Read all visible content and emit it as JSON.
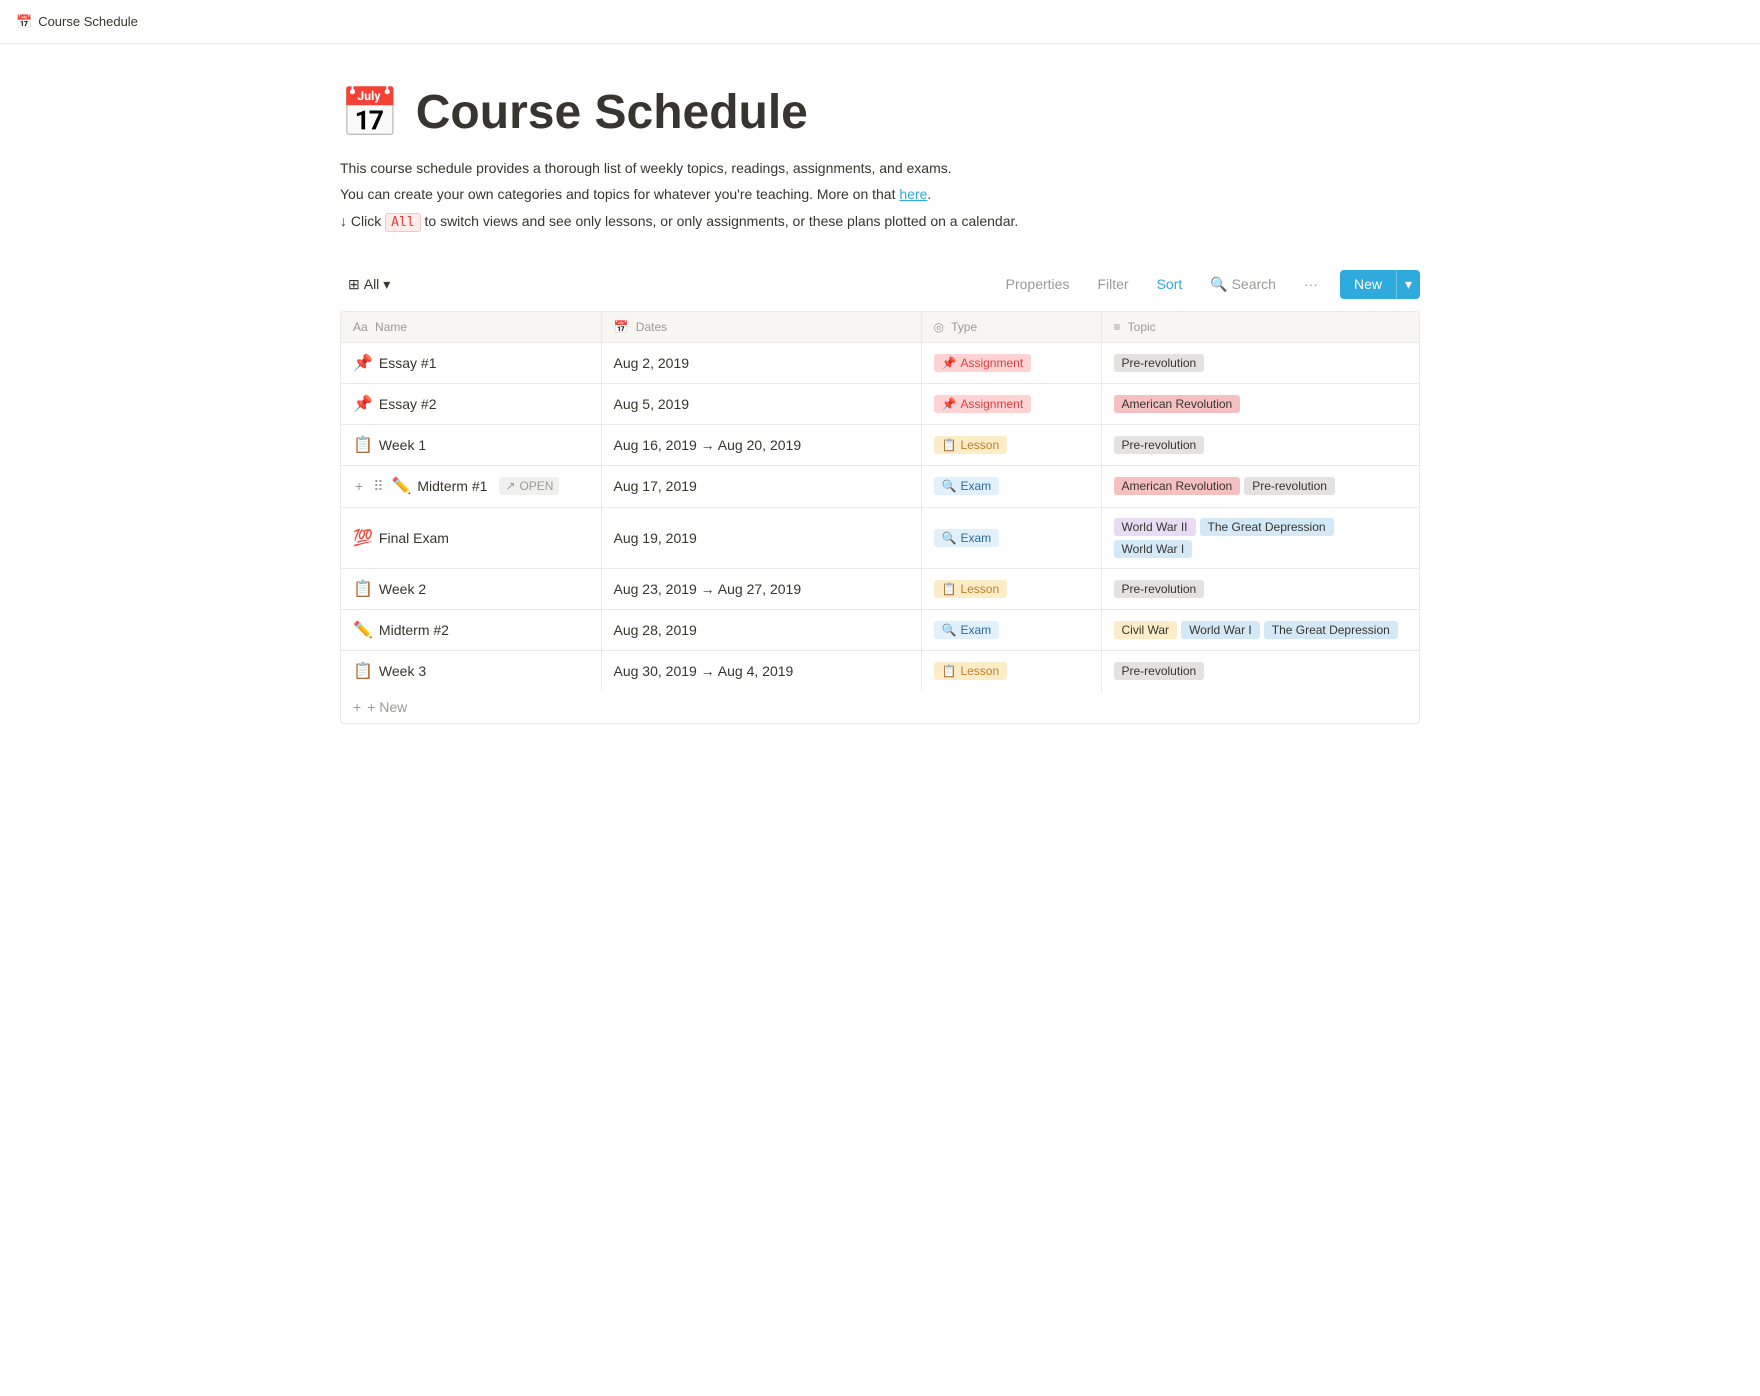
{
  "topbar": {
    "icon": "📅",
    "title": "Course Schedule"
  },
  "page": {
    "icon": "📅",
    "title": "Course Schedule",
    "description": [
      "This course schedule provides a thorough list of weekly topics, readings, assignments, and exams.",
      "You can create your own categories and topics for whatever you're teaching. More on that here.",
      "↓ Click All to switch views and see only lessons, or only assignments, or these plans plotted on a calendar."
    ],
    "highlight_code": "All"
  },
  "toolbar": {
    "view_icon": "⊞",
    "view_label": "All",
    "properties_label": "Properties",
    "filter_label": "Filter",
    "sort_label": "Sort",
    "search_label": "Search",
    "more_label": "···",
    "new_label": "New",
    "chevron": "▾"
  },
  "table": {
    "columns": [
      {
        "icon": "Aa",
        "label": "Name"
      },
      {
        "icon": "📅",
        "label": "Dates"
      },
      {
        "icon": "◎",
        "label": "Type"
      },
      {
        "icon": "≡",
        "label": "Topic"
      }
    ],
    "rows": [
      {
        "emoji": "📌",
        "name": "Essay #1",
        "date": "Aug 2, 2019",
        "type": "Assignment",
        "type_class": "badge-assignment",
        "type_emoji": "📌",
        "topics": [
          {
            "label": "Pre-revolution",
            "class": "tag-gray"
          }
        ]
      },
      {
        "emoji": "📌",
        "name": "Essay #2",
        "date": "Aug 5, 2019",
        "type": "Assignment",
        "type_class": "badge-assignment",
        "type_emoji": "📌",
        "topics": [
          {
            "label": "American Revolution",
            "class": "tag-pink"
          }
        ]
      },
      {
        "emoji": "📋",
        "name": "Week 1",
        "date": "Aug 16, 2019 → Aug 20, 2019",
        "type": "Lesson",
        "type_class": "badge-lesson",
        "type_emoji": "📋",
        "topics": [
          {
            "label": "Pre-revolution",
            "class": "tag-gray"
          }
        ]
      },
      {
        "emoji": "✏️",
        "name": "Midterm #1",
        "date": "Aug 17, 2019",
        "type": "Exam",
        "type_class": "badge-exam",
        "type_emoji": "🔍",
        "is_active": true,
        "topics": [
          {
            "label": "American Revolution",
            "class": "tag-pink"
          },
          {
            "label": "Pre-revolution",
            "class": "tag-gray"
          }
        ]
      },
      {
        "emoji": "💯",
        "name": "Final Exam",
        "date": "Aug 19, 2019",
        "type": "Exam",
        "type_class": "badge-exam",
        "type_emoji": "🔍",
        "topics": [
          {
            "label": "World War II",
            "class": "tag-purple"
          },
          {
            "label": "The Great Depression",
            "class": "tag-blue"
          },
          {
            "label": "World War I",
            "class": "tag-blue"
          }
        ]
      },
      {
        "emoji": "📋",
        "name": "Week 2",
        "date": "Aug 23, 2019 → Aug 27, 2019",
        "type": "Lesson",
        "type_class": "badge-lesson",
        "type_emoji": "📋",
        "topics": [
          {
            "label": "Pre-revolution",
            "class": "tag-gray"
          }
        ]
      },
      {
        "emoji": "✏️",
        "name": "Midterm #2",
        "date": "Aug 28, 2019",
        "type": "Exam",
        "type_class": "badge-exam",
        "type_emoji": "🔍",
        "topics": [
          {
            "label": "Civil War",
            "class": "tag-yellow"
          },
          {
            "label": "World War I",
            "class": "tag-blue"
          },
          {
            "label": "The Great Depression",
            "class": "tag-blue"
          }
        ]
      },
      {
        "emoji": "📋",
        "name": "Week 3",
        "date": "Aug 30, 2019 → Aug 4, 2019",
        "type": "Lesson",
        "type_class": "badge-lesson",
        "type_emoji": "📋",
        "topics": [
          {
            "label": "Pre-revolution",
            "class": "tag-gray"
          }
        ]
      }
    ],
    "add_new_label": "+ New"
  }
}
